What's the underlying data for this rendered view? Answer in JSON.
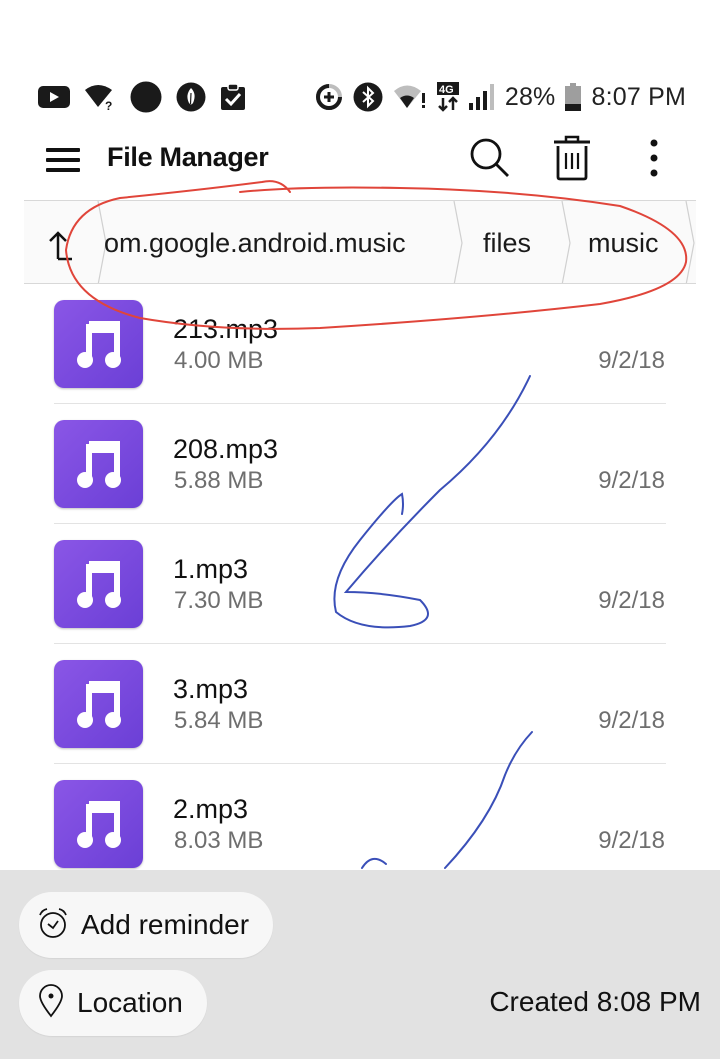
{
  "status_bar": {
    "left_icons": [
      "youtube-icon",
      "wifi-unknown-icon",
      "black-circle-icon",
      "leaf-icon",
      "clipboard-check-icon"
    ],
    "right_icons": [
      "data-saver-icon",
      "bluetooth-icon",
      "wifi-alert-icon",
      "lte-4g-icon",
      "signal-icon",
      "battery-icon"
    ],
    "battery_percent": "28%",
    "battery_level": 0.28,
    "time": "8:07 PM",
    "network_label": "4G"
  },
  "app_bar": {
    "title": "File Manager",
    "actions": [
      "search-icon",
      "trash-icon",
      "more-vert-icon"
    ]
  },
  "breadcrumb": {
    "up_icon": "up-arrow-icon",
    "items": [
      {
        "label": "om.google.android.music"
      },
      {
        "label": "files"
      },
      {
        "label": "music"
      }
    ]
  },
  "files": [
    {
      "name": "213.mp3",
      "size": "4.00 MB",
      "date": "9/2/18",
      "icon": "music-note-icon"
    },
    {
      "name": "208.mp3",
      "size": "5.88 MB",
      "date": "9/2/18",
      "icon": "music-note-icon"
    },
    {
      "name": "1.mp3",
      "size": "7.30 MB",
      "date": "9/2/18",
      "icon": "music-note-icon"
    },
    {
      "name": "3.mp3",
      "size": "5.84 MB",
      "date": "9/2/18",
      "icon": "music-note-icon"
    },
    {
      "name": "2.mp3",
      "size": "8.03 MB",
      "date": "9/2/18",
      "icon": "music-note-icon"
    }
  ],
  "bottom_panel": {
    "reminder_label": "Add reminder",
    "location_label": "Location",
    "created_text": "Created 8:08 PM"
  },
  "colors": {
    "file_icon_purple": "#7a4ae0",
    "annotation_red": "#e0453a",
    "annotation_blue": "#3a4fb8",
    "bottom_panel_bg": "#e2e2e2"
  }
}
